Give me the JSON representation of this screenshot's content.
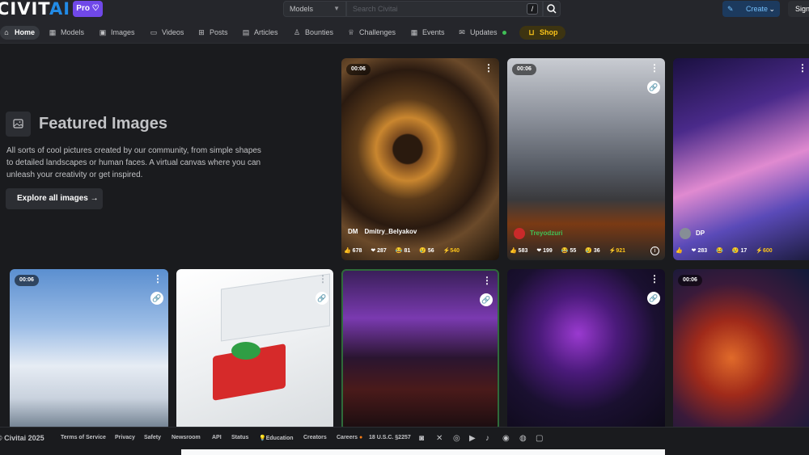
{
  "header": {
    "logo_text": "CIVIT",
    "logo_accent": "AI",
    "pro_label": "Pro",
    "search_category": "Models",
    "search_placeholder": "Search Civitai",
    "shortcut": "/",
    "create_label": "Create",
    "sign_label": "Sign"
  },
  "nav": {
    "items": [
      {
        "label": "Home",
        "icon": "home-icon"
      },
      {
        "label": "Models",
        "icon": "grid-icon"
      },
      {
        "label": "Images",
        "icon": "photo-icon"
      },
      {
        "label": "Videos",
        "icon": "video-icon"
      },
      {
        "label": "Posts",
        "icon": "posts-icon"
      },
      {
        "label": "Articles",
        "icon": "article-icon"
      },
      {
        "label": "Bounties",
        "icon": "bag-icon"
      },
      {
        "label": "Challenges",
        "icon": "trophy-icon"
      },
      {
        "label": "Events",
        "icon": "calendar-icon"
      },
      {
        "label": "Updates",
        "icon": "gift-icon"
      },
      {
        "label": "Shop",
        "icon": "shopping-bag-icon"
      }
    ]
  },
  "hero": {
    "title": "Featured Images",
    "description": "All sorts of cool pictures created by our community, from simple shapes to detailed landscapes or human faces. A virtual canvas where you can unleash your creativity or get inspired.",
    "button_label": "Explore all images"
  },
  "cards": [
    {
      "badge": "00:06",
      "initials": "DM",
      "creator": "Dmitry_Belyakov",
      "likes": "678",
      "hearts": "287",
      "laughs": "81",
      "cries": "56",
      "buzz": "540"
    },
    {
      "badge": "00:06",
      "initials": "",
      "creator": "Treyodzuri",
      "likes": "583",
      "hearts": "199",
      "laughs": "55",
      "cries": "36",
      "buzz": "921"
    },
    {
      "badge": "",
      "initials": "DP",
      "creator": "",
      "likes": "",
      "hearts": "283",
      "laughs": "",
      "cries": "17",
      "buzz": "600"
    },
    {
      "badge": "00:06"
    },
    {
      "badge": ""
    },
    {
      "badge": ""
    },
    {
      "badge": ""
    },
    {
      "badge": "00:06"
    }
  ],
  "footer": {
    "copyright": "© Civitai 2025",
    "links": [
      "Terms of Service",
      "Privacy",
      "Safety",
      "Newsroom",
      "API",
      "Status",
      "Education",
      "Creators",
      "Careers",
      "18 U.S.C. §2257"
    ]
  },
  "colors": {
    "accent": "#228be6",
    "pro": "#7048e8",
    "shop": "#fcc419",
    "background": "#1a1b1e"
  }
}
